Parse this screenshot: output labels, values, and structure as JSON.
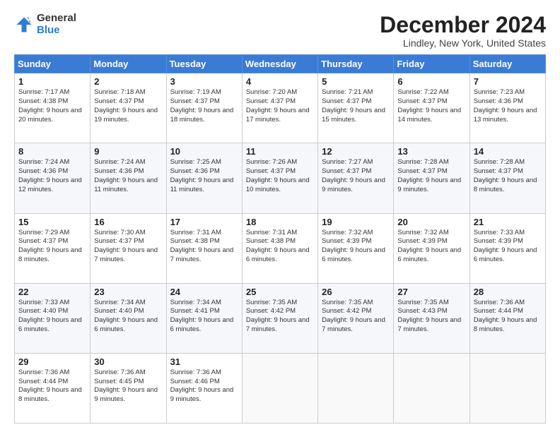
{
  "header": {
    "logo_general": "General",
    "logo_blue": "Blue",
    "month_title": "December 2024",
    "location": "Lindley, New York, United States"
  },
  "calendar": {
    "days_of_week": [
      "Sunday",
      "Monday",
      "Tuesday",
      "Wednesday",
      "Thursday",
      "Friday",
      "Saturday"
    ],
    "weeks": [
      [
        {
          "day": "1",
          "sunrise": "7:17 AM",
          "sunset": "4:38 PM",
          "daylight": "9 hours and 20 minutes."
        },
        {
          "day": "2",
          "sunrise": "7:18 AM",
          "sunset": "4:37 PM",
          "daylight": "9 hours and 19 minutes."
        },
        {
          "day": "3",
          "sunrise": "7:19 AM",
          "sunset": "4:37 PM",
          "daylight": "9 hours and 18 minutes."
        },
        {
          "day": "4",
          "sunrise": "7:20 AM",
          "sunset": "4:37 PM",
          "daylight": "9 hours and 17 minutes."
        },
        {
          "day": "5",
          "sunrise": "7:21 AM",
          "sunset": "4:37 PM",
          "daylight": "9 hours and 15 minutes."
        },
        {
          "day": "6",
          "sunrise": "7:22 AM",
          "sunset": "4:37 PM",
          "daylight": "9 hours and 14 minutes."
        },
        {
          "day": "7",
          "sunrise": "7:23 AM",
          "sunset": "4:36 PM",
          "daylight": "9 hours and 13 minutes."
        }
      ],
      [
        {
          "day": "8",
          "sunrise": "7:24 AM",
          "sunset": "4:36 PM",
          "daylight": "9 hours and 12 minutes."
        },
        {
          "day": "9",
          "sunrise": "7:24 AM",
          "sunset": "4:36 PM",
          "daylight": "9 hours and 11 minutes."
        },
        {
          "day": "10",
          "sunrise": "7:25 AM",
          "sunset": "4:36 PM",
          "daylight": "9 hours and 11 minutes."
        },
        {
          "day": "11",
          "sunrise": "7:26 AM",
          "sunset": "4:37 PM",
          "daylight": "9 hours and 10 minutes."
        },
        {
          "day": "12",
          "sunrise": "7:27 AM",
          "sunset": "4:37 PM",
          "daylight": "9 hours and 9 minutes."
        },
        {
          "day": "13",
          "sunrise": "7:28 AM",
          "sunset": "4:37 PM",
          "daylight": "9 hours and 9 minutes."
        },
        {
          "day": "14",
          "sunrise": "7:28 AM",
          "sunset": "4:37 PM",
          "daylight": "9 hours and 8 minutes."
        }
      ],
      [
        {
          "day": "15",
          "sunrise": "7:29 AM",
          "sunset": "4:37 PM",
          "daylight": "9 hours and 8 minutes."
        },
        {
          "day": "16",
          "sunrise": "7:30 AM",
          "sunset": "4:37 PM",
          "daylight": "9 hours and 7 minutes."
        },
        {
          "day": "17",
          "sunrise": "7:31 AM",
          "sunset": "4:38 PM",
          "daylight": "9 hours and 7 minutes."
        },
        {
          "day": "18",
          "sunrise": "7:31 AM",
          "sunset": "4:38 PM",
          "daylight": "9 hours and 6 minutes."
        },
        {
          "day": "19",
          "sunrise": "7:32 AM",
          "sunset": "4:39 PM",
          "daylight": "9 hours and 6 minutes."
        },
        {
          "day": "20",
          "sunrise": "7:32 AM",
          "sunset": "4:39 PM",
          "daylight": "9 hours and 6 minutes."
        },
        {
          "day": "21",
          "sunrise": "7:33 AM",
          "sunset": "4:39 PM",
          "daylight": "9 hours and 6 minutes."
        }
      ],
      [
        {
          "day": "22",
          "sunrise": "7:33 AM",
          "sunset": "4:40 PM",
          "daylight": "9 hours and 6 minutes."
        },
        {
          "day": "23",
          "sunrise": "7:34 AM",
          "sunset": "4:40 PM",
          "daylight": "9 hours and 6 minutes."
        },
        {
          "day": "24",
          "sunrise": "7:34 AM",
          "sunset": "4:41 PM",
          "daylight": "9 hours and 6 minutes."
        },
        {
          "day": "25",
          "sunrise": "7:35 AM",
          "sunset": "4:42 PM",
          "daylight": "9 hours and 7 minutes."
        },
        {
          "day": "26",
          "sunrise": "7:35 AM",
          "sunset": "4:42 PM",
          "daylight": "9 hours and 7 minutes."
        },
        {
          "day": "27",
          "sunrise": "7:35 AM",
          "sunset": "4:43 PM",
          "daylight": "9 hours and 7 minutes."
        },
        {
          "day": "28",
          "sunrise": "7:36 AM",
          "sunset": "4:44 PM",
          "daylight": "9 hours and 8 minutes."
        }
      ],
      [
        {
          "day": "29",
          "sunrise": "7:36 AM",
          "sunset": "4:44 PM",
          "daylight": "9 hours and 8 minutes."
        },
        {
          "day": "30",
          "sunrise": "7:36 AM",
          "sunset": "4:45 PM",
          "daylight": "9 hours and 9 minutes."
        },
        {
          "day": "31",
          "sunrise": "7:36 AM",
          "sunset": "4:46 PM",
          "daylight": "9 hours and 9 minutes."
        },
        null,
        null,
        null,
        null
      ]
    ]
  }
}
